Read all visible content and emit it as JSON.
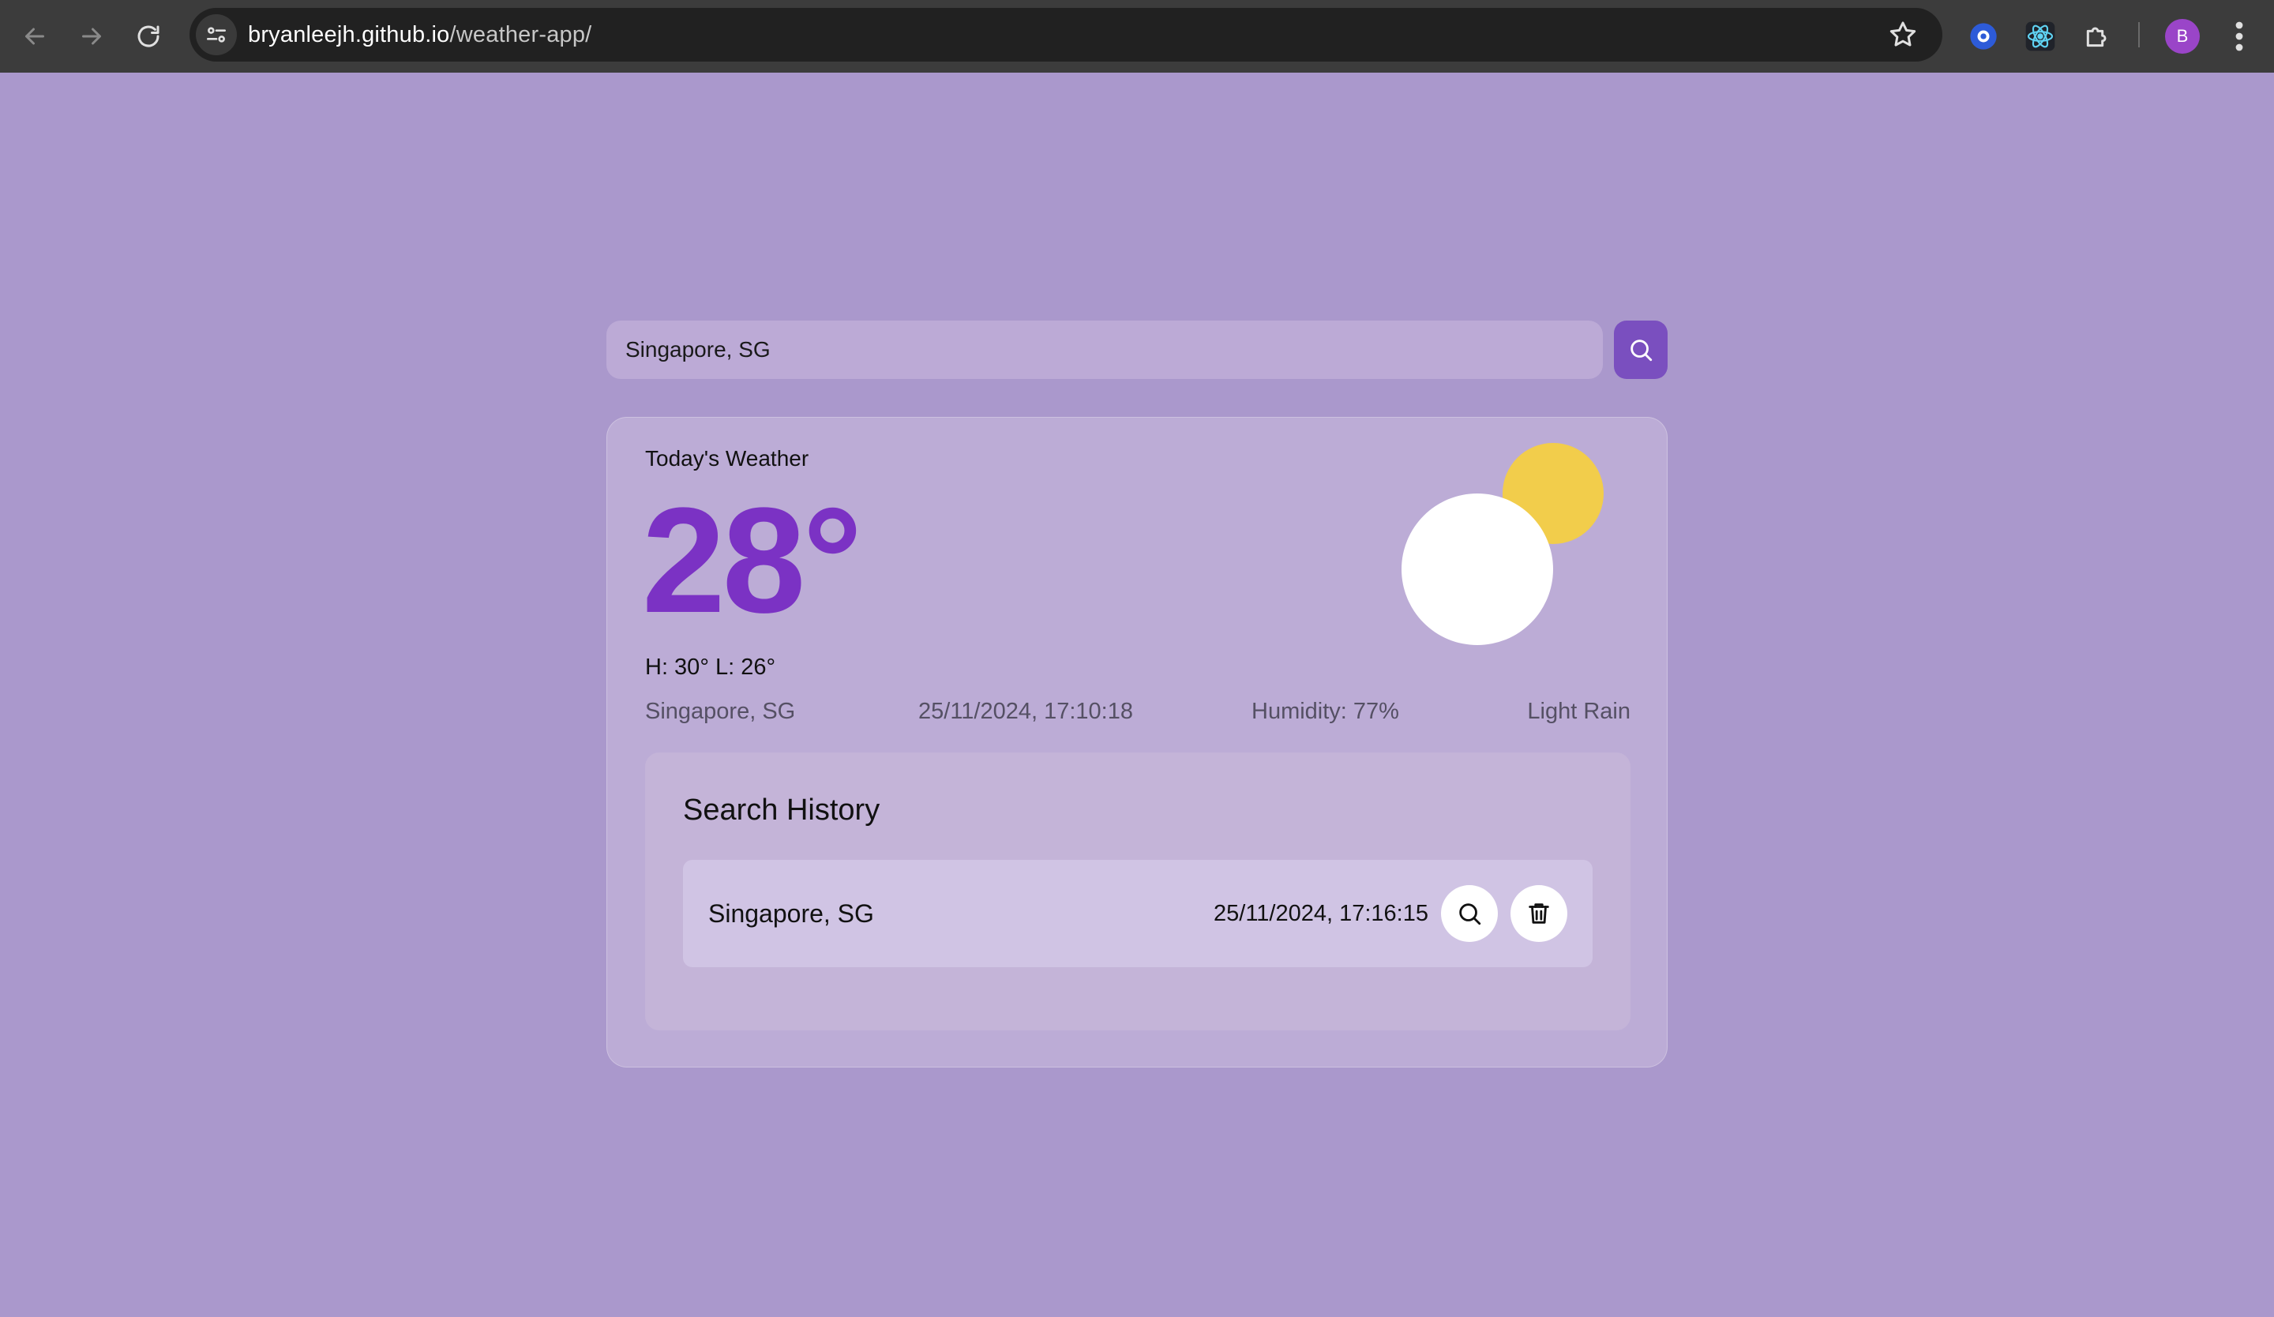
{
  "browser": {
    "url_host": "bryanleejh.github.io",
    "url_path": "/weather-app/",
    "icons": [
      "back-icon",
      "forward-icon",
      "reload-icon",
      "site-info-icon",
      "bookmark-star-icon",
      "extension-icon",
      "react-devtools-icon",
      "puzzle-extensions-icon",
      "menu-icon"
    ],
    "profile_initial": "B"
  },
  "search": {
    "value": "Singapore, SG",
    "placeholder": ""
  },
  "weather": {
    "label": "Today's Weather",
    "temperature": "28°",
    "hilo": "H: 30° L: 26°",
    "location": "Singapore, SG",
    "timestamp": "25/11/2024, 17:10:18",
    "humidity": "Humidity: 77%",
    "condition": "Light Rain"
  },
  "history": {
    "title": "Search History",
    "items": [
      {
        "city": "Singapore, SG",
        "time": "25/11/2024, 17:16:15"
      }
    ]
  },
  "colors": {
    "page_bg": "#aa98cc",
    "accent": "#7a4fbf",
    "temperature": "#7b32c4",
    "sun": "#f2cd4b"
  }
}
